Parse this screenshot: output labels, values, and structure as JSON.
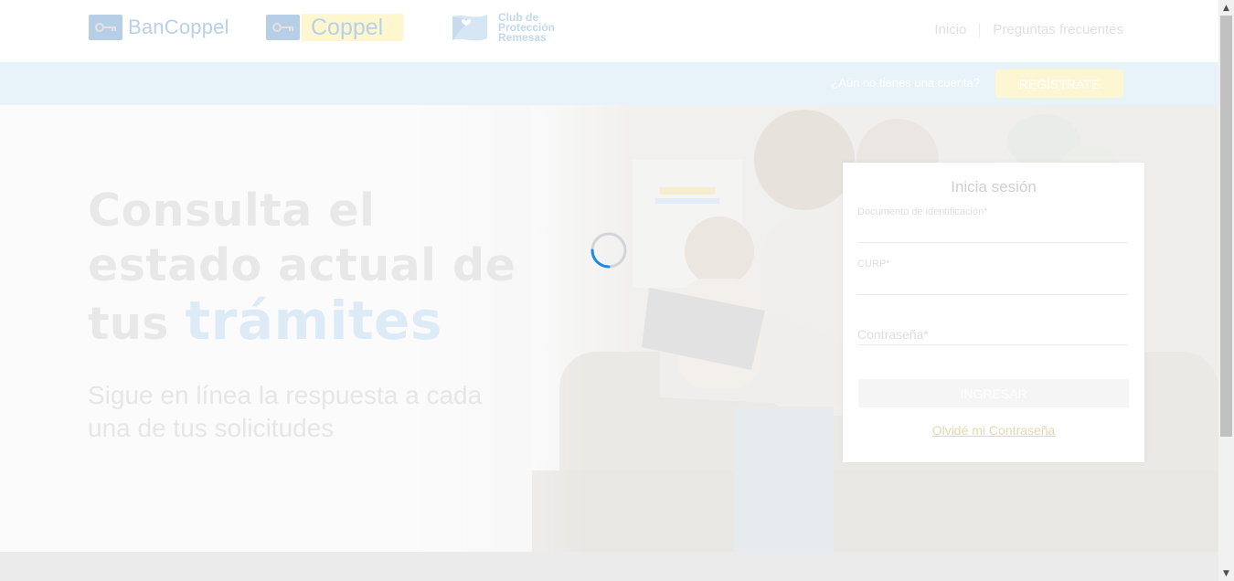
{
  "header": {
    "logos": {
      "bancoppel": "BanCoppel",
      "coppel": "Coppel",
      "club": [
        "Club de",
        "Protección",
        "Remesas"
      ]
    },
    "nav": {
      "home": "Inicio",
      "faq": "Preguntas frecuentes"
    }
  },
  "strip": {
    "question": "¿Aún no tienes una cuenta?",
    "register": "REGÍSTRATE"
  },
  "hero": {
    "title_line1": "Consulta el",
    "title_line2": "estado actual de",
    "title_line3_prefix": "tus ",
    "title_accent": "trámites",
    "subtitle": "Sigue en línea la respuesta a cada una de tus solicitudes"
  },
  "login": {
    "title": "Inicia sesión",
    "id_label": "Documento de identificación*",
    "curp_label": "CURP*",
    "password_label": "Contraseña*",
    "submit": "INGRESAR",
    "forgot": "Olvidé mi Contraseña"
  },
  "icons": {
    "key": "key-icon",
    "flag": "heart-flag-icon",
    "spinner": "loading-spinner-icon",
    "scroll_up": "scroll-up-arrow-icon",
    "scroll_down": "scroll-down-arrow-icon"
  },
  "colors": {
    "brand_blue": "#b9d1e8",
    "brand_yellow": "#fdf6cf",
    "strip_bg": "#e8f2f9",
    "spinner_blue": "#1e88e5"
  }
}
